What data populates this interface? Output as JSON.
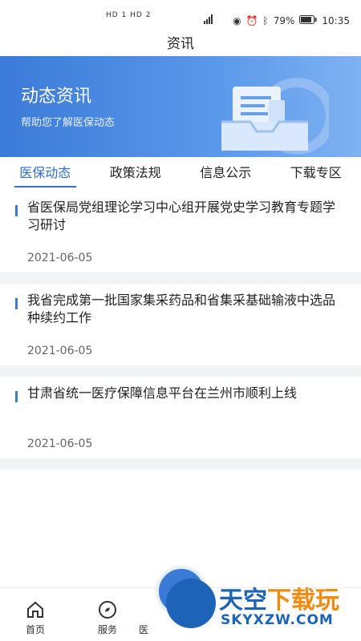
{
  "status_bar": {
    "left": "HD 1  HD 2",
    "network": "4G 4G",
    "battery": "79%",
    "time": "10:35"
  },
  "header": {
    "title": "资讯"
  },
  "banner": {
    "title": "动态资讯",
    "subtitle": "帮助您了解医保动态"
  },
  "tabs": [
    {
      "label": "医保动态",
      "active": true
    },
    {
      "label": "政策法规",
      "active": false
    },
    {
      "label": "信息公示",
      "active": false
    },
    {
      "label": "下载专区",
      "active": false
    }
  ],
  "news": [
    {
      "title": "省医保局党组理论学习中心组开展党史学习教育专题学习研讨",
      "date": "2021-06-05"
    },
    {
      "title": "我省完成第一批国家集采药品和省集采基础输液中选品种续约工作",
      "date": "2021-06-05"
    },
    {
      "title": "甘肃省统一医疗保障信息平台在兰州市顺利上线",
      "date": "2021-06-05"
    }
  ],
  "bottom_nav": {
    "home": "首页",
    "service": "服务",
    "partial": "医"
  },
  "watermark": {
    "cn1": "天空",
    "cn2": "下载玩",
    "domain": "SKYXZW.COM"
  },
  "colors": {
    "accent": "#2f6fd0",
    "banner": "#3b7bd8"
  }
}
